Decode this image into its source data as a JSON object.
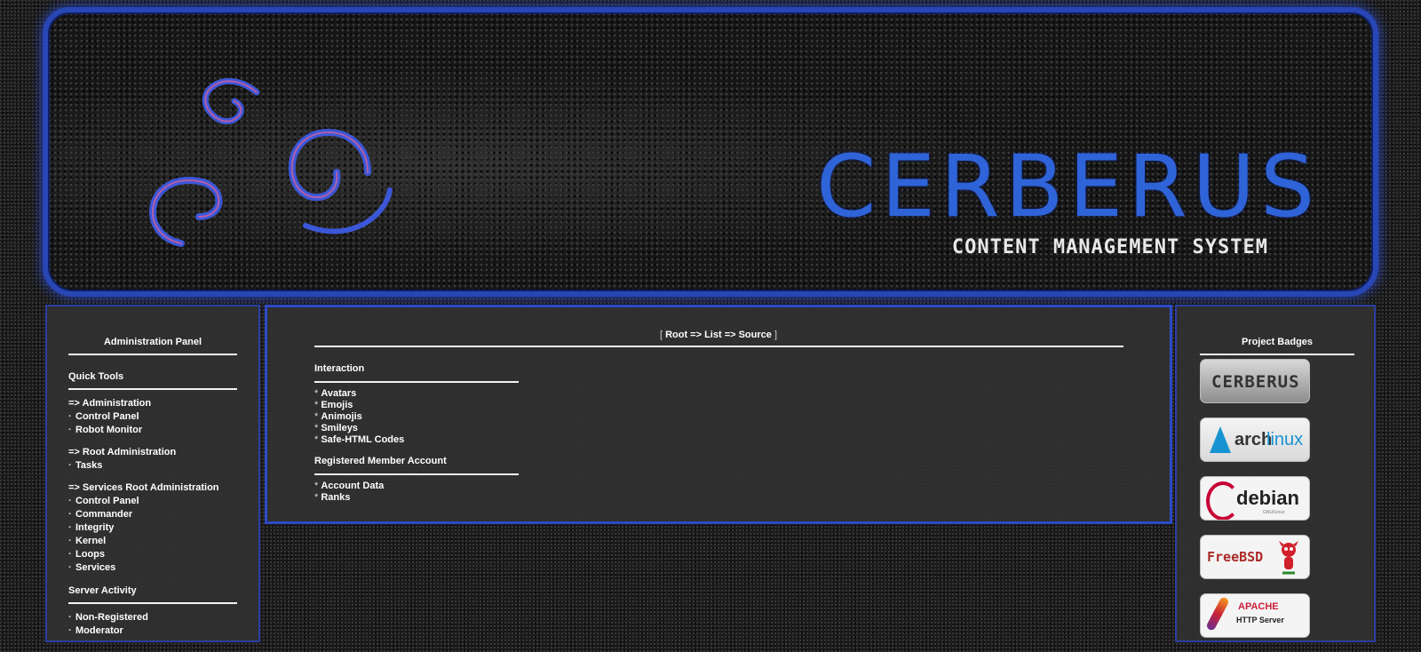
{
  "banner": {
    "title": "CERBERUS",
    "subtitle": "CONTENT MANAGEMENT SYSTEM"
  },
  "left": {
    "title": "Administration Panel",
    "quick_tools": {
      "heading": "Quick Tools",
      "groups": [
        {
          "head": "=> Administration",
          "items": [
            "Control Panel",
            "Robot Monitor"
          ]
        },
        {
          "head": "=> Root Administration",
          "items": [
            "Tasks"
          ]
        },
        {
          "head": "=> Services Root Administration",
          "items": [
            "Control Panel",
            "Commander",
            "Integrity",
            "Kernel",
            "Loops",
            "Services"
          ]
        }
      ]
    },
    "server_activity": {
      "heading": "Server Activity",
      "items": [
        "Non-Registered",
        "Moderator"
      ]
    }
  },
  "center": {
    "breadcrumb": "Root => List => Source",
    "bracket_open": "[",
    "bracket_close": "]",
    "categories": [
      {
        "name": "Interaction",
        "items": [
          "Avatars",
          "Emojis",
          "Animojis",
          "Smileys",
          "Safe-HTML Codes"
        ]
      },
      {
        "name": "Registered Member Account",
        "items": [
          "Account Data",
          "Ranks"
        ]
      }
    ]
  },
  "right": {
    "title": "Project Badges",
    "badges": {
      "cerberus": "CERBERUS",
      "arch_a": "arch",
      "arch_b": "linux",
      "debian": "debian",
      "debian_sub": "GNU/Linux",
      "freebsd": "FreeBSD",
      "apache": "APACHE",
      "apache_sub": "HTTP Server"
    }
  },
  "colors": {
    "border_blue": "#2d49c8",
    "brand_blue": "#2f63d8",
    "panel_bg": "#303030"
  }
}
